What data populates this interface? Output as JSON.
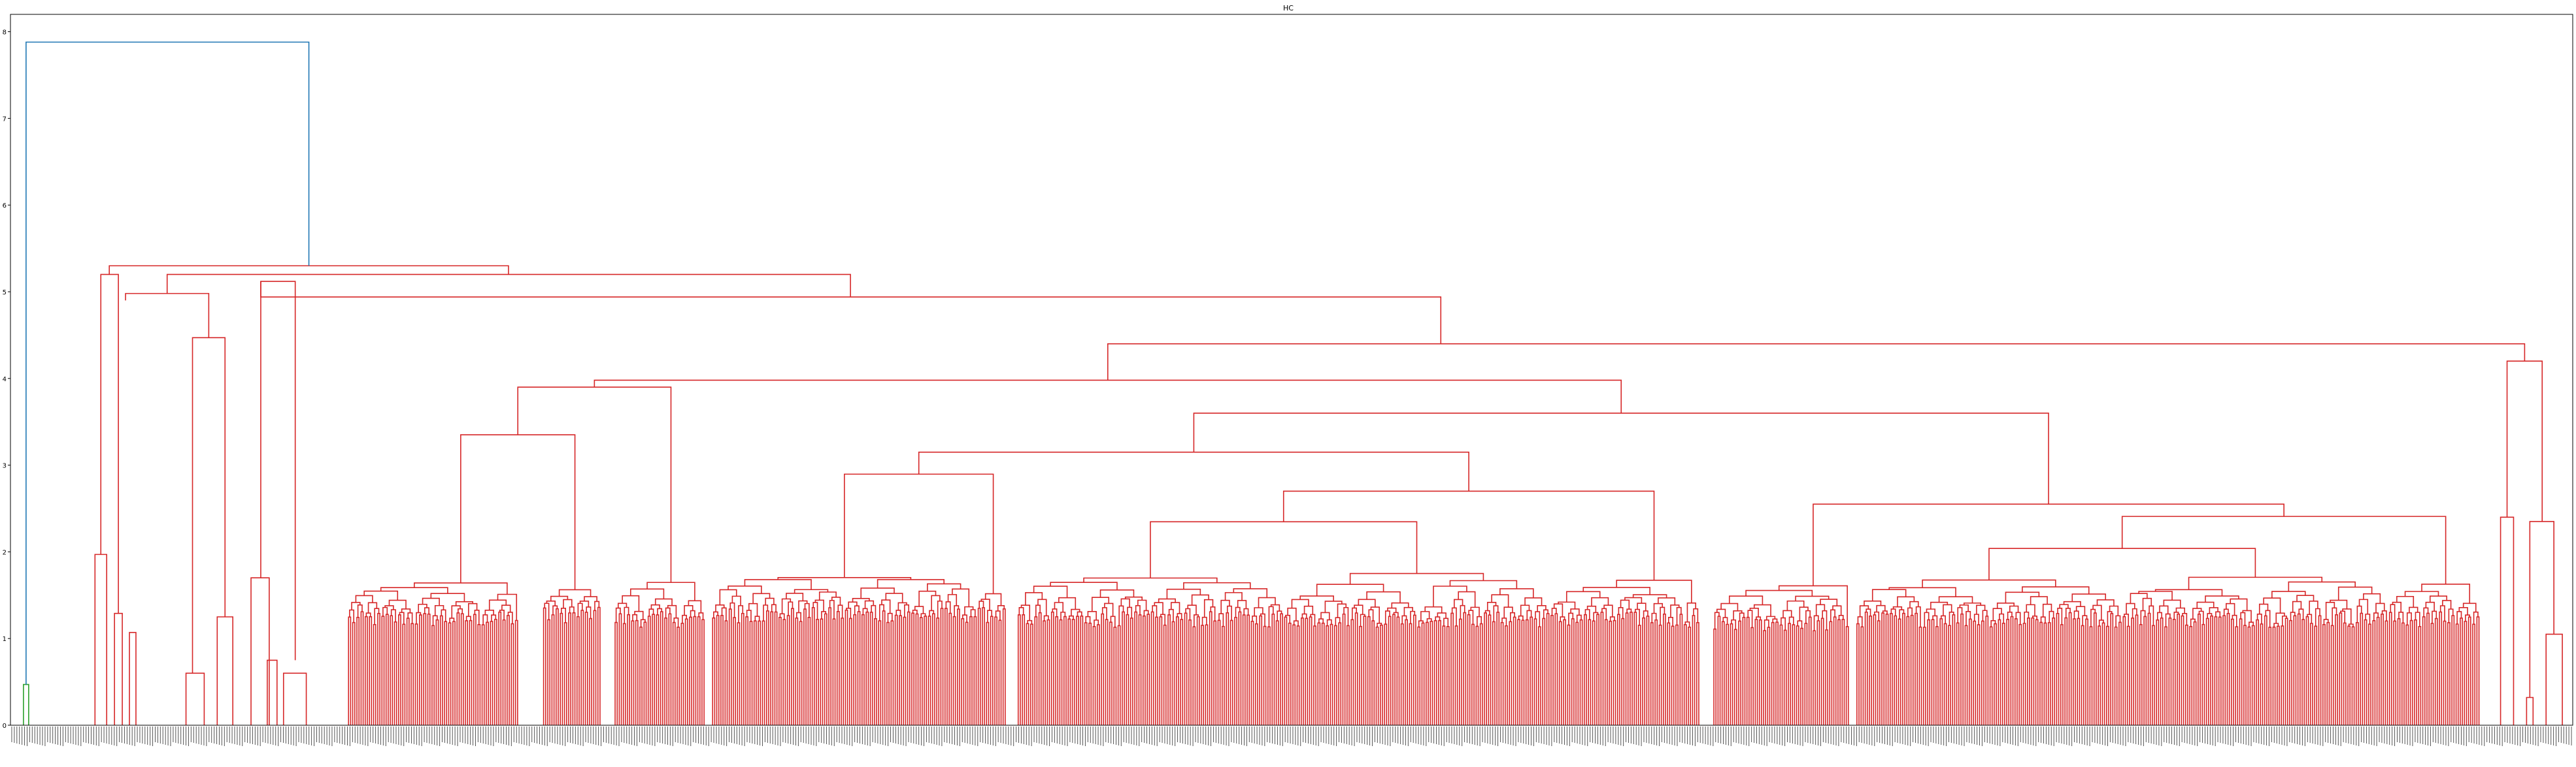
{
  "chart_data": {
    "type": "dendrogram",
    "title": "HC",
    "xlabel": "",
    "ylabel": "",
    "ylim": [
      0,
      8.2
    ],
    "yticks": [
      "0",
      "1",
      "2",
      "3",
      "4",
      "5",
      "6",
      "7",
      "8"
    ],
    "grid": false,
    "legend": "none",
    "colors": {
      "link_above_threshold": "#1f77b4",
      "cluster_1": "#2ca02c",
      "cluster_2": "#d62728",
      "axis": "#000000"
    },
    "leaf_count_estimate": 1000,
    "merge_heights": {
      "root": 7.88,
      "cluster_2_top": 5.3,
      "main_subclusters": [
        5.2,
        5.12,
        4.98,
        4.94,
        4.47,
        4.4,
        3.98
      ],
      "left_small_clusters": [
        1.97,
        1.29,
        1.25,
        1.07,
        0.6
      ],
      "large_block_merge": 4.47,
      "right_block": [
        4.2,
        2.4,
        1.05,
        0.32
      ],
      "cluster_1_merge": 0.47,
      "typical_leaf_merge": 1.25
    }
  }
}
